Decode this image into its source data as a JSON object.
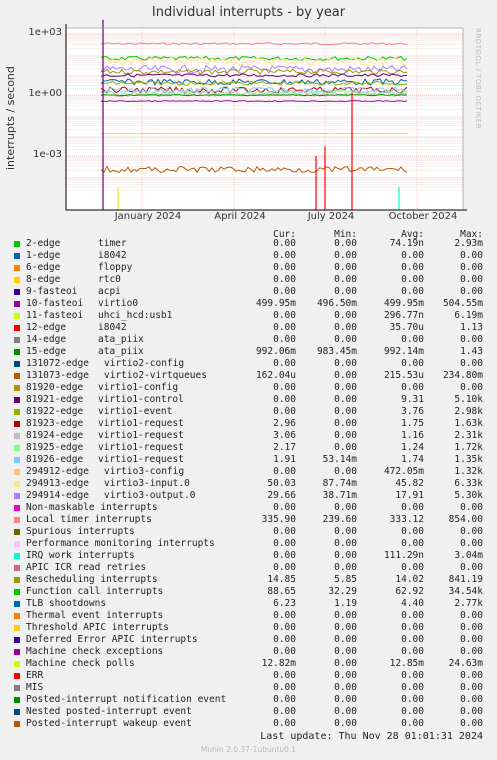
{
  "chart_data": {
    "type": "line",
    "title": "Individual interrupts - by year",
    "ylabel": "interrupts / second",
    "yscale": "log",
    "ylim": [
      1e-05,
      10000
    ],
    "yticks": [
      "1e+03",
      "1e+00",
      "1e-03"
    ],
    "xticks": [
      "January 2024",
      "April 2024",
      "July 2024",
      "October 2024"
    ],
    "watermark": "RRDTOOL / TOBI OETIKER",
    "columns": [
      "Cur:",
      "Min:",
      "Avg:",
      "Max:"
    ],
    "series": [
      {
        "name": "2-edge",
        "device": "timer",
        "color": "#00cc00",
        "cur": "0.00",
        "min": "0.00",
        "avg": "74.19n",
        "max": "2.93m"
      },
      {
        "name": "1-edge",
        "device": "i8042",
        "color": "#0066b3",
        "cur": "0.00",
        "min": "0.00",
        "avg": "0.00",
        "max": "0.00"
      },
      {
        "name": "6-edge",
        "device": "floppy",
        "color": "#ff8000",
        "cur": "0.00",
        "min": "0.00",
        "avg": "0.00",
        "max": "0.00"
      },
      {
        "name": "8-edge",
        "device": "rtc0",
        "color": "#ffcc00",
        "cur": "0.00",
        "min": "0.00",
        "avg": "0.00",
        "max": "0.00"
      },
      {
        "name": "9-fasteoi",
        "device": "acpi",
        "color": "#330099",
        "cur": "0.00",
        "min": "0.00",
        "avg": "0.00",
        "max": "0.00"
      },
      {
        "name": "10-fasteoi",
        "device": "virtio0",
        "color": "#990099",
        "cur": "499.95m",
        "min": "496.50m",
        "avg": "499.95m",
        "max": "504.55m"
      },
      {
        "name": "11-fasteoi",
        "device": "uhci_hcd:usb1",
        "color": "#ccff00",
        "cur": "0.00",
        "min": "0.00",
        "avg": "296.77n",
        "max": "6.19m"
      },
      {
        "name": "12-edge",
        "device": "i8042",
        "color": "#ff0000",
        "cur": "0.00",
        "min": "0.00",
        "avg": "35.70u",
        "max": "1.13"
      },
      {
        "name": "14-edge",
        "device": "ata_piix",
        "color": "#808080",
        "cur": "0.00",
        "min": "0.00",
        "avg": "0.00",
        "max": "0.00"
      },
      {
        "name": "15-edge",
        "device": "ata_piix",
        "color": "#008f00",
        "cur": "992.06m",
        "min": "983.45m",
        "avg": "992.14m",
        "max": "1.43"
      },
      {
        "name": "131072-edge",
        "device": "virtio2-config",
        "color": "#00487d",
        "cur": "0.00",
        "min": "0.00",
        "avg": "0.00",
        "max": "0.00"
      },
      {
        "name": "131073-edge",
        "device": "virtio2-virtqueues",
        "color": "#b35a00",
        "cur": "162.04u",
        "min": "0.00",
        "avg": "215.53u",
        "max": "234.80m"
      },
      {
        "name": "81920-edge",
        "device": "virtio1-config",
        "color": "#b38f00",
        "cur": "0.00",
        "min": "0.00",
        "avg": "0.00",
        "max": "0.00"
      },
      {
        "name": "81921-edge",
        "device": "virtio1-control",
        "color": "#6b006b",
        "cur": "0.00",
        "min": "0.00",
        "avg": "9.31",
        "max": "5.10k"
      },
      {
        "name": "81922-edge",
        "device": "virtio1-event",
        "color": "#8fb300",
        "cur": "0.00",
        "min": "0.00",
        "avg": "3.76",
        "max": "2.98k"
      },
      {
        "name": "81923-edge",
        "device": "virtio1-request",
        "color": "#b30000",
        "cur": "2.96",
        "min": "0.00",
        "avg": "1.75",
        "max": "1.63k"
      },
      {
        "name": "81924-edge",
        "device": "virtio1-request",
        "color": "#bebebe",
        "cur": "3.06",
        "min": "0.00",
        "avg": "1.16",
        "max": "2.31k"
      },
      {
        "name": "81925-edge",
        "device": "virtio1-request",
        "color": "#80ff80",
        "cur": "2.17",
        "min": "0.00",
        "avg": "1.24",
        "max": "1.72k"
      },
      {
        "name": "81926-edge",
        "device": "virtio1-request",
        "color": "#80c9ff",
        "cur": "1.91",
        "min": "53.14m",
        "avg": "1.74",
        "max": "1.35k"
      },
      {
        "name": "294912-edge",
        "device": "virtio3-config",
        "color": "#ffc080",
        "cur": "0.00",
        "min": "0.00",
        "avg": "472.05m",
        "max": "1.32k"
      },
      {
        "name": "294913-edge",
        "device": "virtio3-input.0",
        "color": "#ffe680",
        "cur": "50.03",
        "min": "87.74m",
        "avg": "45.82",
        "max": "6.33k"
      },
      {
        "name": "294914-edge",
        "device": "virtio3-output.0",
        "color": "#aa80ff",
        "cur": "29.66",
        "min": "38.71m",
        "avg": "17.91",
        "max": "5.30k"
      },
      {
        "name": "Non-maskable interrupts",
        "device": "",
        "color": "#ee00cc",
        "cur": "0.00",
        "min": "0.00",
        "avg": "0.00",
        "max": "0.00"
      },
      {
        "name": "Local timer interrupts",
        "device": "",
        "color": "#ff8080",
        "cur": "335.90",
        "min": "239.60",
        "avg": "333.12",
        "max": "854.00"
      },
      {
        "name": "Spurious interrupts",
        "device": "",
        "color": "#666600",
        "cur": "0.00",
        "min": "0.00",
        "avg": "0.00",
        "max": "0.00"
      },
      {
        "name": "Performance monitoring interrupts",
        "device": "",
        "color": "#ffbfff",
        "cur": "0.00",
        "min": "0.00",
        "avg": "0.00",
        "max": "0.00"
      },
      {
        "name": "IRQ work interrupts",
        "device": "",
        "color": "#00ffcc",
        "cur": "0.00",
        "min": "0.00",
        "avg": "111.29n",
        "max": "3.04m"
      },
      {
        "name": "APIC ICR read retries",
        "device": "",
        "color": "#cc6699",
        "cur": "0.00",
        "min": "0.00",
        "avg": "0.00",
        "max": "0.00"
      },
      {
        "name": "Rescheduling interrupts",
        "device": "",
        "color": "#999900",
        "cur": "14.85",
        "min": "5.85",
        "avg": "14.02",
        "max": "841.19"
      },
      {
        "name": "Function call interrupts",
        "device": "",
        "color": "#00cc00",
        "cur": "88.65",
        "min": "32.29",
        "avg": "62.92",
        "max": "34.54k"
      },
      {
        "name": "TLB shootdowns",
        "device": "",
        "color": "#0066b3",
        "cur": "6.23",
        "min": "1.19",
        "avg": "4.40",
        "max": "2.77k"
      },
      {
        "name": "Thermal event interrupts",
        "device": "",
        "color": "#ff8000",
        "cur": "0.00",
        "min": "0.00",
        "avg": "0.00",
        "max": "0.00"
      },
      {
        "name": "Threshold APIC interrupts",
        "device": "",
        "color": "#ffcc00",
        "cur": "0.00",
        "min": "0.00",
        "avg": "0.00",
        "max": "0.00"
      },
      {
        "name": "Deferred Error APIC interrupts",
        "device": "",
        "color": "#330099",
        "cur": "0.00",
        "min": "0.00",
        "avg": "0.00",
        "max": "0.00"
      },
      {
        "name": "Machine check exceptions",
        "device": "",
        "color": "#990099",
        "cur": "0.00",
        "min": "0.00",
        "avg": "0.00",
        "max": "0.00"
      },
      {
        "name": "Machine check polls",
        "device": "",
        "color": "#ccff00",
        "cur": "12.82m",
        "min": "0.00",
        "avg": "12.85m",
        "max": "24.63m"
      },
      {
        "name": "ERR",
        "device": "",
        "color": "#ff0000",
        "cur": "0.00",
        "min": "0.00",
        "avg": "0.00",
        "max": "0.00"
      },
      {
        "name": "MIS",
        "device": "",
        "color": "#808080",
        "cur": "0.00",
        "min": "0.00",
        "avg": "0.00",
        "max": "0.00"
      },
      {
        "name": "Posted-interrupt notification event",
        "device": "",
        "color": "#008f00",
        "cur": "0.00",
        "min": "0.00",
        "avg": "0.00",
        "max": "0.00"
      },
      {
        "name": "Nested posted-interrupt event",
        "device": "",
        "color": "#00487d",
        "cur": "0.00",
        "min": "0.00",
        "avg": "0.00",
        "max": "0.00"
      },
      {
        "name": "Posted-interrupt wakeup event",
        "device": "",
        "color": "#b35a00",
        "cur": "0.00",
        "min": "0.00",
        "avg": "0.00",
        "max": "0.00"
      }
    ],
    "last_update": "Last update: Thu Nov 28 01:01:31 2024",
    "footer": "Munin 2.0.37-1ubuntu0.1"
  }
}
